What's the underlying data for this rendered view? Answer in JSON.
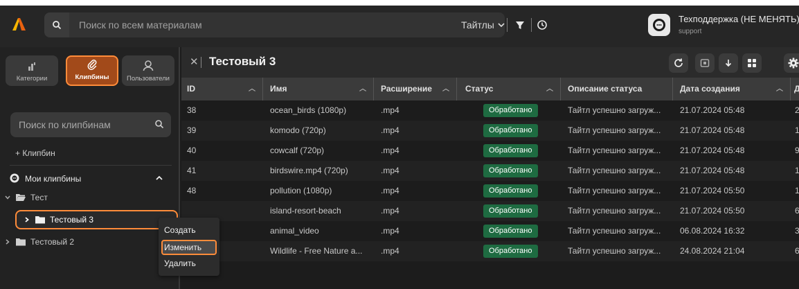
{
  "topbar": {
    "search_placeholder": "Поиск по всем материалам",
    "scope_label": "Тайтлы",
    "support_name": "Техподдержка (НЕ МЕНЯТЬ)",
    "support_login": "support"
  },
  "sidebar": {
    "tabs": [
      {
        "label": "Категории",
        "icon": "categories-icon"
      },
      {
        "label": "Клипбины",
        "icon": "paperclip-icon",
        "active": true
      },
      {
        "label": "Пользователи",
        "icon": "user-icon"
      }
    ],
    "search_placeholder": "Поиск по клипбинам",
    "add_label": "+ Клипбин",
    "my_clipbins": "Мои клипбины",
    "tree": [
      {
        "label": "Тест",
        "expanded": true
      },
      {
        "label": "Тестовый 3",
        "selected": true
      },
      {
        "label": "Тестовый 2"
      }
    ]
  },
  "context_menu": {
    "items": [
      "Создать",
      "Изменить",
      "Удалить"
    ],
    "highlighted": "Изменить"
  },
  "main": {
    "title": "Тестовый 3",
    "columns": [
      "ID",
      "Имя",
      "Расширение",
      "Статус",
      "Описание статуса",
      "Дата создания",
      "Д"
    ],
    "rows": [
      {
        "id": "38",
        "name": "ocean_birds (1080p)",
        "ext": ".mp4",
        "status": "Обработано",
        "desc": "Тайтл успешно загруж...",
        "date": "21.07.2024 05:48",
        "extra": "2"
      },
      {
        "id": "39",
        "name": "komodo (720p)",
        "ext": ".mp4",
        "status": "Обработано",
        "desc": "Тайтл успешно загруж...",
        "date": "21.07.2024 05:48",
        "extra": "1"
      },
      {
        "id": "40",
        "name": "cowcalf (720p)",
        "ext": ".mp4",
        "status": "Обработано",
        "desc": "Тайтл успешно загруж...",
        "date": "21.07.2024 05:48",
        "extra": "9"
      },
      {
        "id": "41",
        "name": "birdswire.mp4 (720p)",
        "ext": ".mp4",
        "status": "Обработано",
        "desc": "Тайтл успешно загруж...",
        "date": "21.07.2024 05:48",
        "extra": "1"
      },
      {
        "id": "48",
        "name": "pollution (1080p)",
        "ext": ".mp4",
        "status": "Обработано",
        "desc": "Тайтл успешно загруж...",
        "date": "21.07.2024 05:50",
        "extra": "1"
      },
      {
        "id": "",
        "name": "island-resort-beach",
        "ext": ".mp4",
        "status": "Обработано",
        "desc": "Тайтл успешно загруж...",
        "date": "21.07.2024 05:50",
        "extra": "6"
      },
      {
        "id": "",
        "name": "animal_video",
        "ext": ".mp4",
        "status": "Обработано",
        "desc": "Тайтл успешно загруж...",
        "date": "06.08.2024 16:32",
        "extra": "3"
      },
      {
        "id": "",
        "name": "Wildlife - Free Nature a...",
        "ext": ".mp4",
        "status": "Обработано",
        "desc": "Тайтл успешно загруж...",
        "date": "24.08.2024 21:04",
        "extra": "6"
      }
    ]
  },
  "colors": {
    "accent": "#ff8c3a",
    "status_ok": "#1e6b41"
  }
}
